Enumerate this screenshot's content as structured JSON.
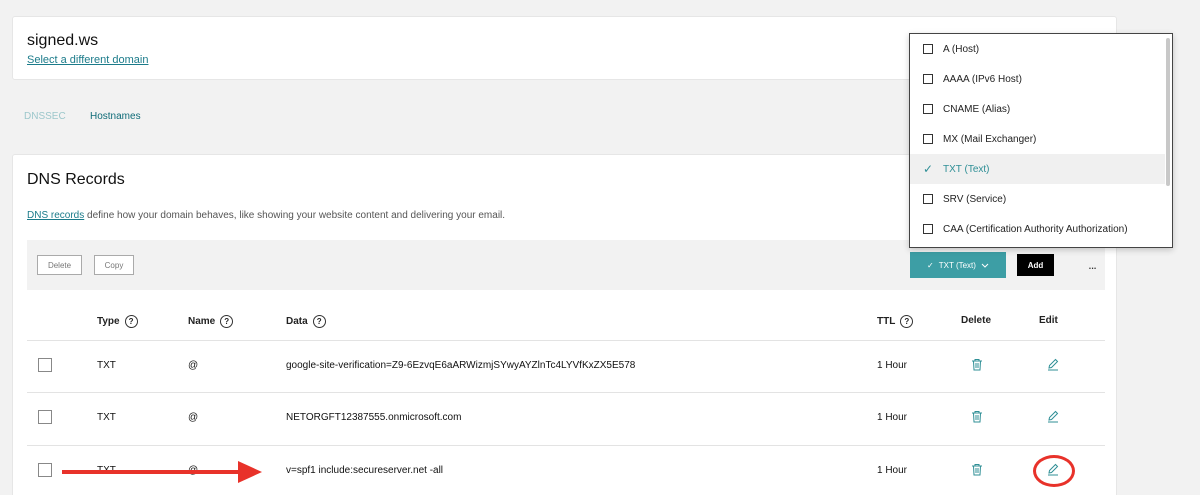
{
  "domain": {
    "name": "signed.ws",
    "change_link": "Select a different domain"
  },
  "subtabs": {
    "dnssec": "DNSSEC",
    "hostnames": "Hostnames"
  },
  "records": {
    "title": "DNS Records",
    "desc_link": "DNS records",
    "desc_text": " define how your domain behaves, like showing your website content and delivering your email."
  },
  "toolbar": {
    "delete_label": "Delete",
    "copy_label": "Copy",
    "type_filter": "TXT (Text)",
    "add_label": "Add",
    "more_label": "..."
  },
  "table": {
    "headers": {
      "type": "Type",
      "name": "Name",
      "data": "Data",
      "ttl": "TTL",
      "delete": "Delete",
      "edit": "Edit"
    },
    "help_glyph": "?",
    "rows": [
      {
        "type": "TXT",
        "name": "@",
        "data": "google-site-verification=Z9-6EzvqE6aARWizmjSYwyAYZlnTc4LYVfKxZX5E578",
        "ttl": "1 Hour"
      },
      {
        "type": "TXT",
        "name": "@",
        "data": "NETORGFT12387555.onmicrosoft.com",
        "ttl": "1 Hour"
      },
      {
        "type": "TXT",
        "name": "@",
        "data": "v=spf1 include:secureserver.net -all",
        "ttl": "1 Hour"
      }
    ]
  },
  "dropdown": {
    "items": [
      {
        "label": "A (Host)",
        "selected": false
      },
      {
        "label": "AAAA (IPv6 Host)",
        "selected": false
      },
      {
        "label": "CNAME (Alias)",
        "selected": false
      },
      {
        "label": "MX (Mail Exchanger)",
        "selected": false
      },
      {
        "label": "TXT (Text)",
        "selected": true
      },
      {
        "label": "SRV (Service)",
        "selected": false
      },
      {
        "label": "CAA (Certification Authority Authorization)",
        "selected": false
      }
    ]
  },
  "colors": {
    "accent": "#3d9ea5",
    "link": "#1b7b8a",
    "annotation": "#e8322a"
  },
  "icons": {
    "trash": "trash-icon",
    "edit": "pencil-icon",
    "check": "check-icon",
    "chevron": "chevron-down-icon"
  }
}
